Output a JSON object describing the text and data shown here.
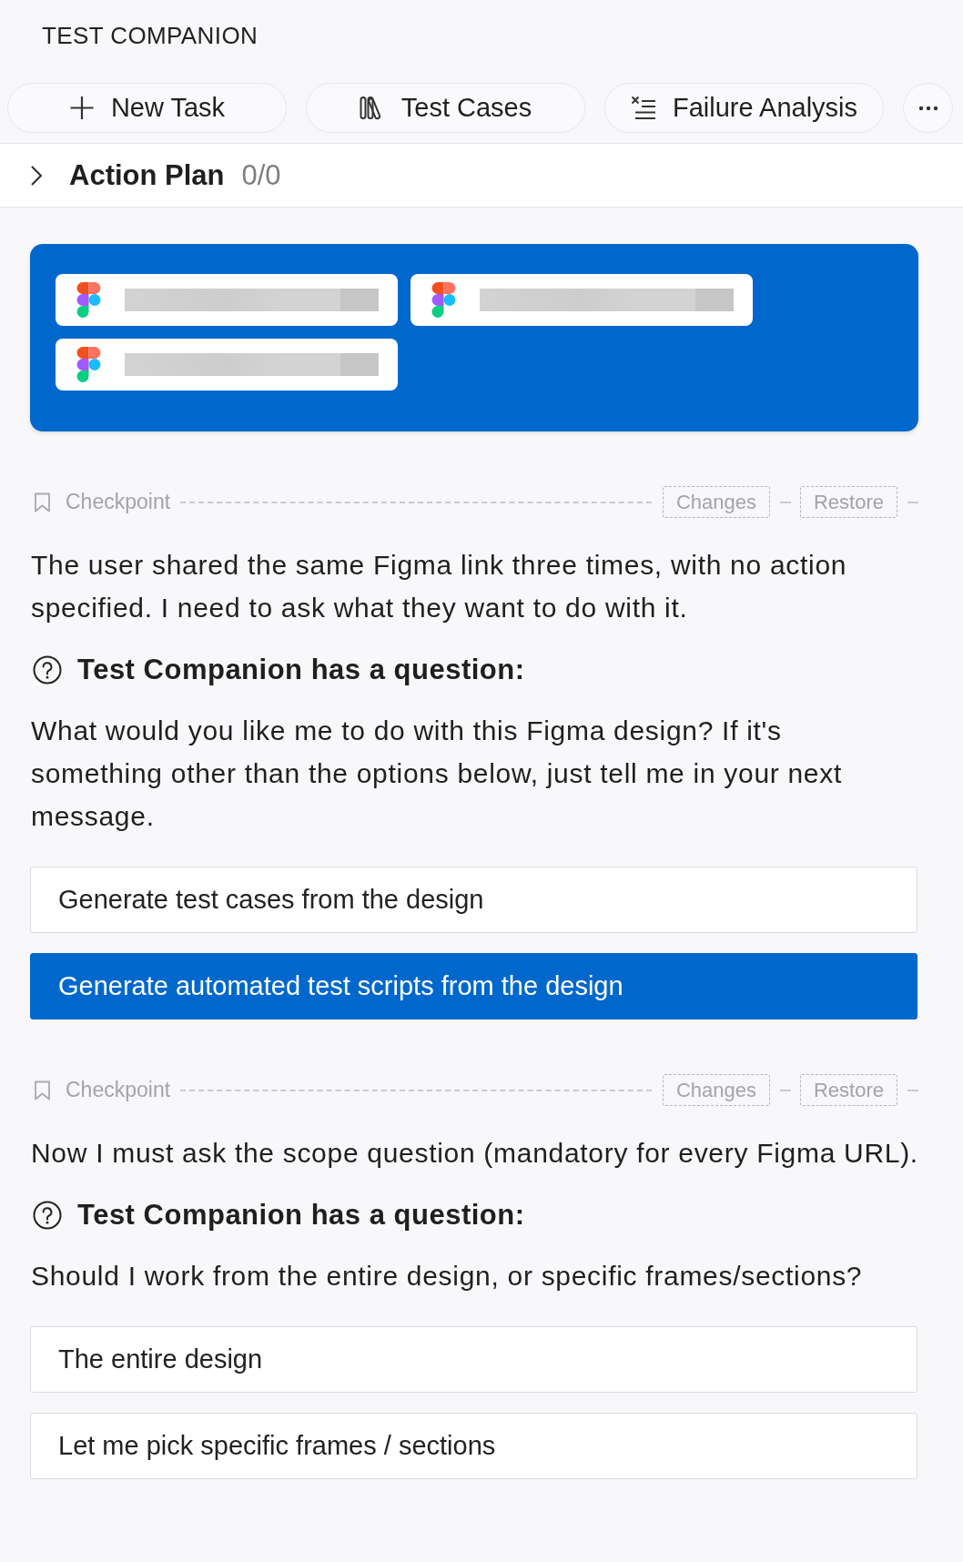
{
  "header": {
    "title": "TEST COMPANION"
  },
  "toolbar": [
    {
      "kind": "add",
      "label": "New Task"
    },
    {
      "kind": "cases",
      "label": "Test Cases"
    },
    {
      "kind": "failure",
      "label": "Failure Analysis"
    },
    {
      "kind": "more"
    }
  ],
  "action_plan": {
    "title": "Action Plan",
    "count": "0/0",
    "expanded": false
  },
  "attachments": [
    {
      "kind": "figma"
    },
    {
      "kind": "figma"
    },
    {
      "kind": "figma"
    }
  ],
  "messages": [
    {
      "kind": "checkpoint",
      "label": "Checkpoint",
      "actions": [
        "Changes",
        "Restore"
      ]
    },
    {
      "kind": "text",
      "text": "The user shared the same Figma link three times, with no action specified. I need to ask what they want to do with it."
    },
    {
      "kind": "question",
      "heading": "Test Companion has a question:",
      "text": "What would you like me to do with this Figma design? If it's something other than the options below, just tell me in your next message.",
      "options": [
        {
          "label": "Generate test cases from the design",
          "selected": false
        },
        {
          "label": "Generate automated test scripts from the design",
          "selected": true
        }
      ]
    },
    {
      "kind": "checkpoint",
      "label": "Checkpoint",
      "actions": [
        "Changes",
        "Restore"
      ]
    },
    {
      "kind": "text",
      "text": "Now I must ask the scope question (mandatory for every Figma URL)."
    },
    {
      "kind": "question",
      "heading": "Test Companion has a question:",
      "text": "Should I work from the entire design, or specific frames/sections?",
      "options": [
        {
          "label": "The entire design",
          "selected": false
        },
        {
          "label": "Let me pick specific frames / sections",
          "selected": false
        }
      ]
    }
  ]
}
